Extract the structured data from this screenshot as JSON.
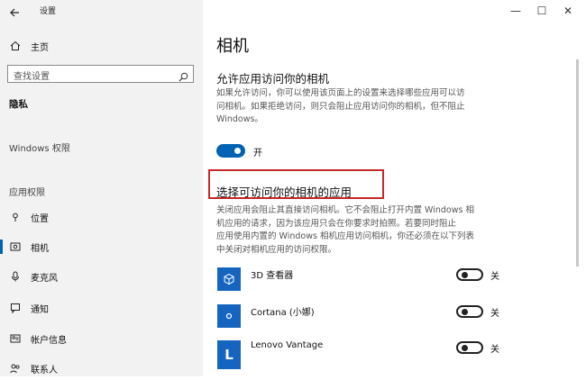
{
  "titlebar": {
    "back_icon": "back-arrow-icon",
    "title": "设置",
    "min": "—",
    "max": "☐",
    "close": "✕"
  },
  "sidebar": {
    "home_label": "主页",
    "search_placeholder": "查找设置",
    "privacy_heading": "隐私",
    "windows_permissions": "Windows 权限",
    "app_permissions": "应用权限",
    "items": [
      {
        "label": "位置",
        "icon": "location-icon"
      },
      {
        "label": "相机",
        "icon": "camera-icon",
        "selected": true
      },
      {
        "label": "麦克风",
        "icon": "microphone-icon"
      },
      {
        "label": "通知",
        "icon": "notification-icon"
      },
      {
        "label": "帐户信息",
        "icon": "account-info-icon"
      },
      {
        "label": "联系人",
        "icon": "contacts-icon"
      }
    ]
  },
  "main": {
    "page_title": "相机",
    "allow_heading": "允许应用访问你的相机",
    "allow_desc_1": "如果允许访问，你可以使用该页面上的设置来选择哪些应用可以访",
    "allow_desc_2": "问相机。如果拒绝访问，则只会阻止应用访问你的相机，但不阻止",
    "allow_desc_3": "Windows。",
    "master_toggle_label": "开",
    "choose_heading": "选择可访问你的相机的应用",
    "choose_desc_1": "关闭应用会阻止其直接访问相机。它不会阻止打开内置 Windows 相",
    "choose_desc_2": "机应用的请求，因为该应用只会在你要求时拍照。若要同时阻止",
    "choose_desc_3": "应用使用内置的 Windows 相机应用访问相机，你还必须在以下列表",
    "choose_desc_4": "中关闭对相机应用的访问权限。",
    "apps": [
      {
        "name": "3D 查看器",
        "toggle": "关",
        "icon": "cube-icon"
      },
      {
        "name": "Cortana (小娜)",
        "toggle": "关",
        "icon": "cortana-circle-icon"
      },
      {
        "name": "Lenovo Vantage",
        "toggle": "关",
        "icon": "lenovo-l-icon"
      }
    ]
  },
  "colors": {
    "accent": "#0063b1",
    "highlight_box": "#c62828",
    "app_icon_bg": "#1565c0"
  }
}
